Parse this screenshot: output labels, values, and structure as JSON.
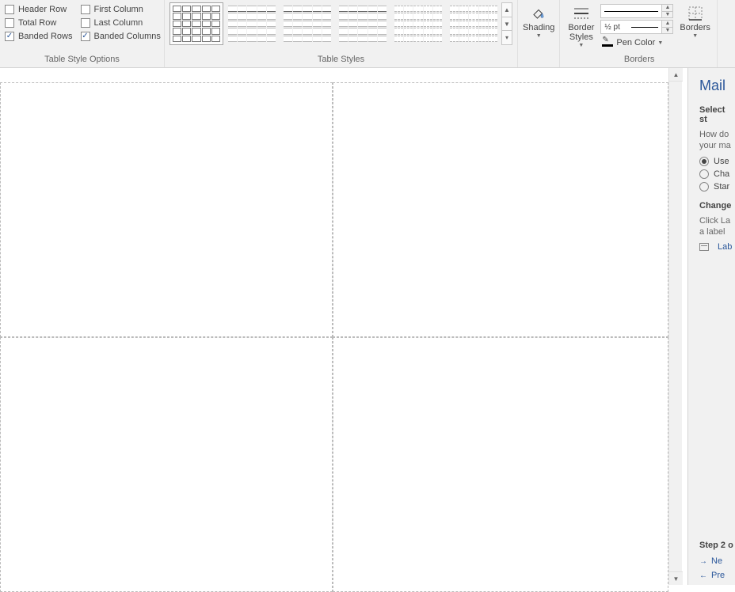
{
  "ribbon": {
    "table_style_options": {
      "label": "Table Style Options",
      "header_row": "Header Row",
      "total_row": "Total Row",
      "banded_rows": "Banded Rows",
      "first_column": "First Column",
      "last_column": "Last Column",
      "banded_columns": "Banded Columns",
      "checked": {
        "header_row": false,
        "total_row": false,
        "banded_rows": true,
        "first_column": false,
        "last_column": false,
        "banded_columns": true
      }
    },
    "table_styles": {
      "label": "Table Styles"
    },
    "shading": {
      "label": "Shading"
    },
    "border_styles": {
      "label": "Border\nStyles"
    },
    "borders": {
      "group_label": "Borders",
      "line_weight": "½ pt",
      "pen_color": "Pen Color",
      "borders_btn": "Borders"
    }
  },
  "mailpane": {
    "title": "Mail",
    "select_heading": "Select st",
    "howdo": "How do",
    "yourma": "your ma",
    "opt_use": "Use",
    "opt_cha": "Cha",
    "opt_start": "Star",
    "change_heading": "Change ",
    "clickla": "Click La",
    "alabel": "a label ",
    "label_link": "Lab",
    "step": "Step 2 o",
    "next": "Ne",
    "prev": "Pre"
  }
}
